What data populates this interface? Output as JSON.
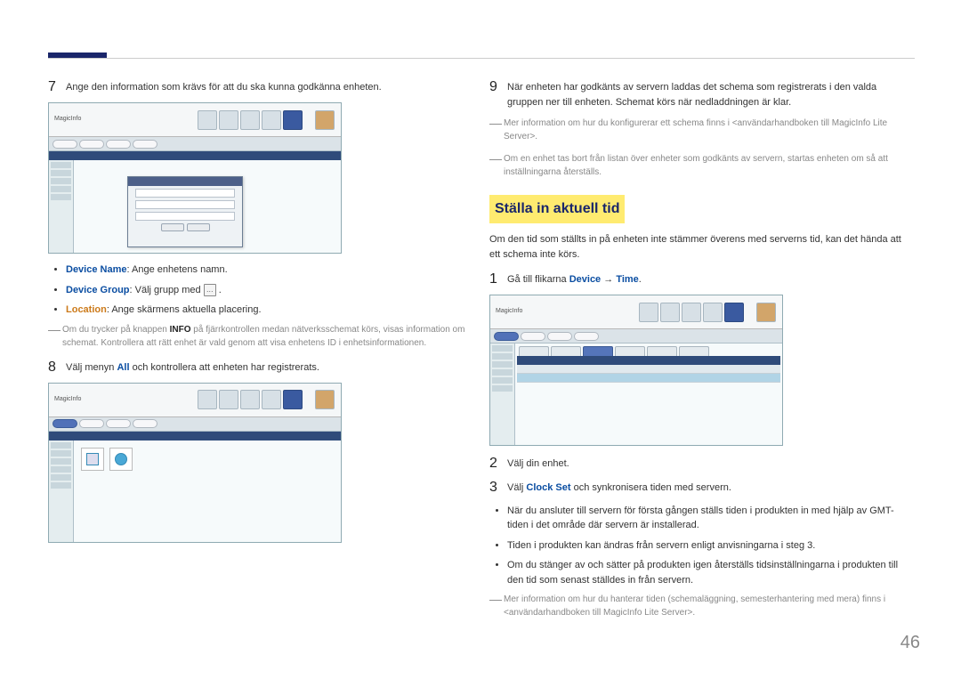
{
  "left": {
    "step7": {
      "num": "7",
      "text": "Ange den information som krävs för att du ska kunna godkänna enheten."
    },
    "bullets": {
      "device_name_label": "Device Name",
      "device_name_text": ": Ange enhetens namn.",
      "device_group_label": "Device Group",
      "device_group_pre": ": Välj grupp med ",
      "device_group_post": " .",
      "location_label": "Location",
      "location_text": ": Ange skärmens aktuella placering."
    },
    "note1": "Om du trycker på knappen INFO på fjärrkontrollen medan nätverksschemat körs, visas information om schemat. Kontrollera att rätt enhet är vald genom att visa enhetens ID i enhetsinformationen.",
    "step8": {
      "num": "8",
      "pre": "Välj menyn ",
      "bold": "All",
      "post": " och kontrollera att enheten har registrerats."
    },
    "ss_logo": "MagicInfo",
    "ellipsis": "…"
  },
  "right": {
    "step9": {
      "num": "9",
      "text": "När enheten har godkänts av servern laddas det schema som registrerats i den valda gruppen ner till enheten. Schemat körs när nedladdningen är klar."
    },
    "notes": [
      "Mer information om hur du konfigurerar ett schema finns i <användarhandboken till MagicInfo Lite Server>.",
      "Om en enhet tas bort från listan över enheter som godkänts av servern, startas enheten om så att inställningarna återställs."
    ],
    "heading": "Ställa in aktuell tid",
    "intro": "Om den tid som ställts in på enheten inte stämmer överens med serverns tid, kan det hända att ett schema inte körs.",
    "step1": {
      "num": "1",
      "pre": "Gå till flikarna ",
      "link1": "Device",
      "arrow": " → ",
      "link2": "Time",
      "post": "."
    },
    "step2": {
      "num": "2",
      "text": "Välj din enhet."
    },
    "step3": {
      "num": "3",
      "pre": "Välj ",
      "link": "Clock Set",
      "post": " och synkronisera tiden med servern."
    },
    "end_bullets": [
      "När du ansluter till servern för första gången ställs tiden i produkten in med hjälp av GMT-tiden i det område där servern är installerad.",
      "Tiden i produkten kan ändras från servern enligt anvisningarna i steg 3.",
      "Om du stänger av och sätter på produkten igen återställs tidsinställningarna i produkten till den tid som senast ställdes in från servern."
    ],
    "end_note": "Mer information om hur du hanterar tiden (schemaläggning, semesterhantering med mera) finns i <användarhandboken till MagicInfo Lite Server>."
  },
  "pagenum": "46"
}
